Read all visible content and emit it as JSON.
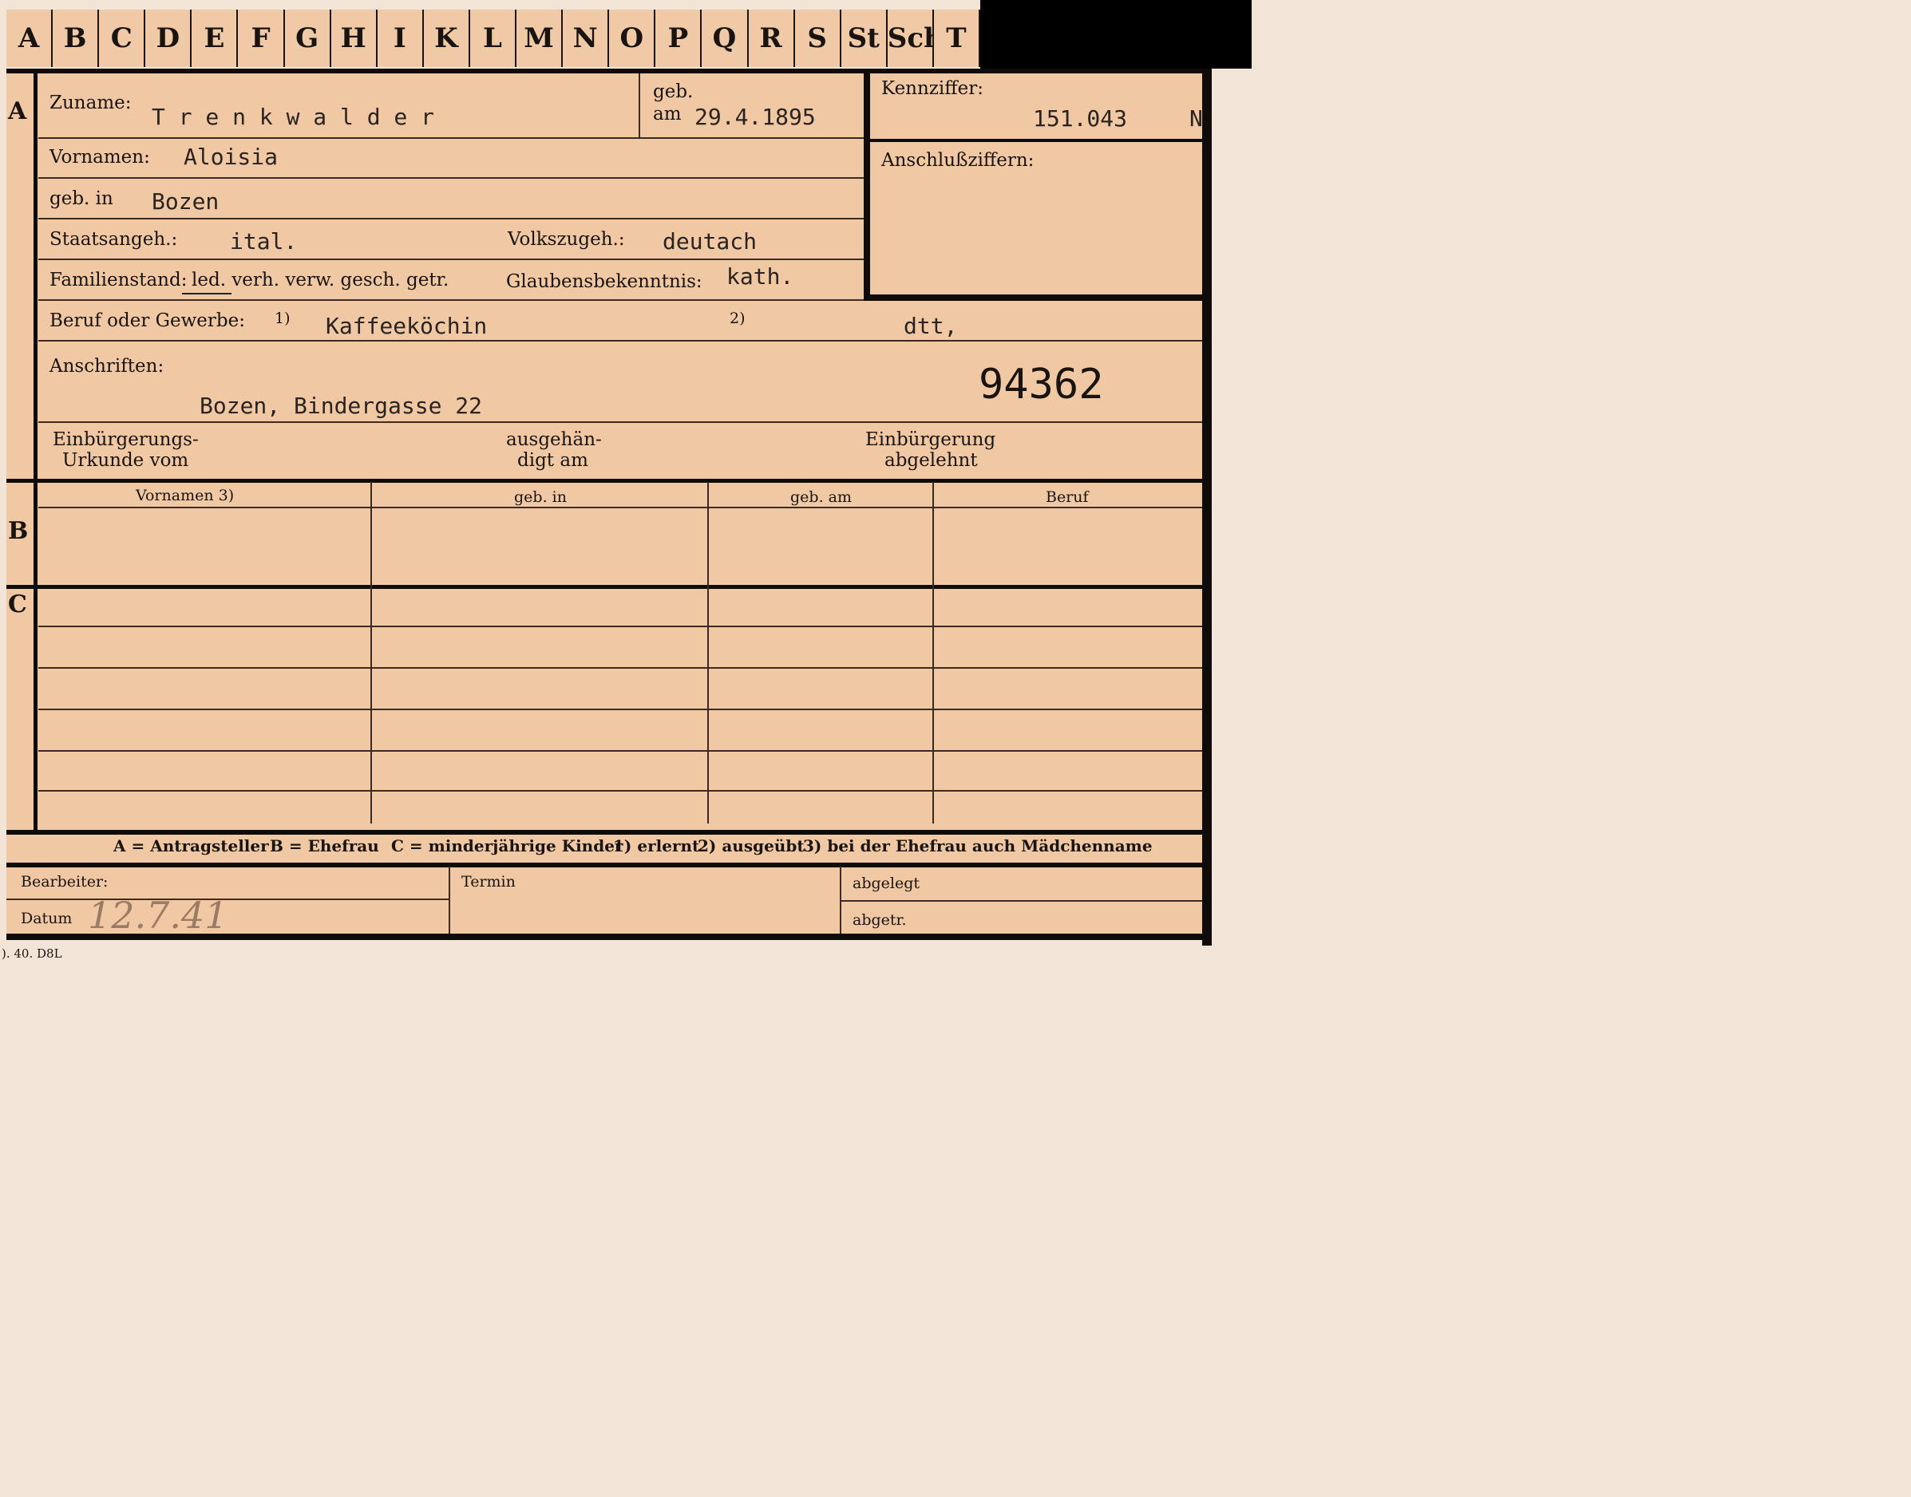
{
  "tabs": [
    "A",
    "B",
    "C",
    "D",
    "E",
    "F",
    "G",
    "H",
    "I",
    "K",
    "L",
    "M",
    "N",
    "O",
    "P",
    "Q",
    "R",
    "S",
    "St",
    "Sch",
    "T"
  ],
  "section_a": "A",
  "section_b": "B",
  "section_c": "C",
  "labels": {
    "zuname": "Zuname:",
    "geb": "geb.",
    "am": "am",
    "kennziffer": "Kennziffer:",
    "anschlussziffern": "Anschlußziffern:",
    "vornamen": "Vornamen:",
    "geb_in": "geb. in",
    "staatsangeh": "Staatsangeh.:",
    "volkszugeh": "Volkszugeh.:",
    "familienstand": "Familienstand:",
    "fam_options": "led. verh. verw. gesch. getr.",
    "glaubensbekenntnis": "Glaubensbekenntnis:",
    "beruf_oder_gewerbe": "Beruf oder Gewerbe:",
    "fn1": "1)",
    "fn2": "2)",
    "anschriften": "Anschriften:",
    "einb_urkunde_1": "Einbürgerungs-",
    "einb_urkunde_2": "Urkunde vom",
    "ausgehaendigt_1": "ausgehän-",
    "ausgehaendigt_2": "digt am",
    "einb_abgelehnt_1": "Einbürgerung",
    "einb_abgelehnt_2": "abgelehnt"
  },
  "values": {
    "zuname": "T r e n k w a l d e r",
    "geb_am": "29.4.1895",
    "kennziffer": "151.043",
    "kennziffer_suffix": "N",
    "vornamen": "Aloisia",
    "geb_in": "Bozen",
    "staatsangeh": "ital.",
    "volkszugeh": "deutach",
    "glaubensbekenntnis": "kath.",
    "beruf_erlernt": "Kaffeeköchin",
    "beruf_ausgeuebt": "dtt,",
    "anschrift": "Bozen, Bindergasse  22",
    "stamp_number": "94362"
  },
  "table": {
    "headers": [
      "Vornamen 3)",
      "geb. in",
      "geb. am",
      "Beruf"
    ]
  },
  "legend": {
    "a": "A = Antragsteller",
    "b": "B = Ehefrau",
    "c": "C = minderjährige Kinder",
    "n1": "1) erlernt",
    "n2": "2) ausgeübt",
    "n3": "3) bei der Ehefrau auch Mädchenname"
  },
  "footer": {
    "bearbeiter": "Bearbeiter:",
    "datum": "Datum",
    "datum_value": "12.7.41",
    "termin": "Termin",
    "abgelegt": "abgelegt",
    "abgetr": "abgetr.",
    "print_code": "). 40. D8L"
  }
}
